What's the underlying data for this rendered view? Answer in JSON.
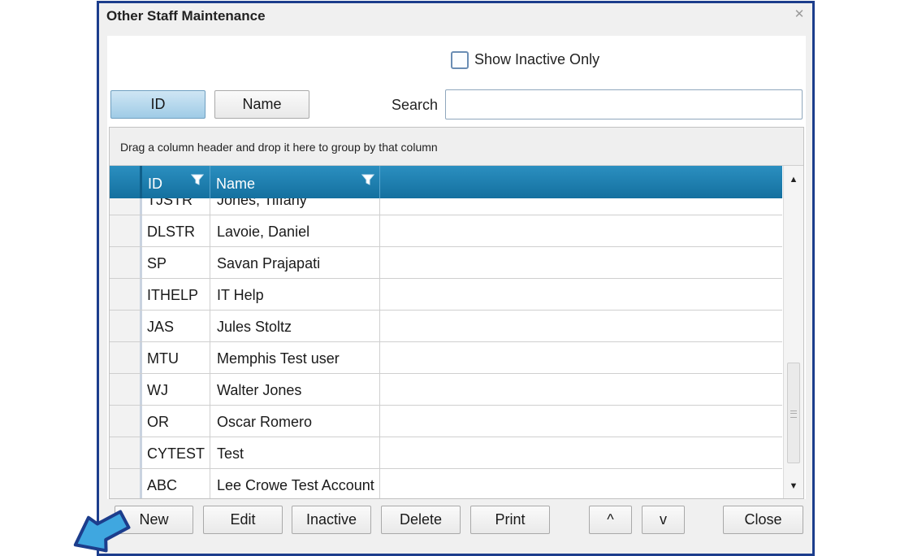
{
  "window": {
    "title": "Other Staff Maintenance",
    "close_glyph": "✕"
  },
  "filter": {
    "show_inactive_label": "Show Inactive Only",
    "show_inactive_checked": false
  },
  "search": {
    "sort_buttons": [
      "ID",
      "Name"
    ],
    "active_sort": "ID",
    "label": "Search",
    "value": ""
  },
  "grid": {
    "group_hint": "Drag a column header and drop it here to group by that column",
    "columns": [
      "ID",
      "Name"
    ],
    "rows": [
      {
        "id": "TJSTR",
        "name": "Jones, Tiffany"
      },
      {
        "id": "DLSTR",
        "name": "Lavoie, Daniel"
      },
      {
        "id": "SP",
        "name": "Savan Prajapati"
      },
      {
        "id": "ITHELP",
        "name": "IT Help"
      },
      {
        "id": "JAS",
        "name": "Jules Stoltz"
      },
      {
        "id": "MTU",
        "name": "Memphis Test user"
      },
      {
        "id": "WJ",
        "name": "Walter Jones"
      },
      {
        "id": "OR",
        "name": "Oscar Romero"
      },
      {
        "id": "CYTEST",
        "name": "Test"
      },
      {
        "id": "ABC",
        "name": "Lee Crowe Test Account"
      }
    ],
    "scroll_up_glyph": "▲",
    "scroll_down_glyph": "▼"
  },
  "actions": {
    "new": "New",
    "edit": "Edit",
    "inactive": "Inactive",
    "delete": "Delete",
    "print": "Print",
    "move_up": "^",
    "move_down": "v",
    "close": "Close"
  },
  "icons": {
    "column_filter": "funnel-icon",
    "pointer": "arrow-pointer-icon"
  },
  "colors": {
    "window_border": "#1c3d8c",
    "header_blue": "#1a7fb2",
    "active_button": "#a9d2ea",
    "pointer_arrow": "#3fa7e0"
  }
}
